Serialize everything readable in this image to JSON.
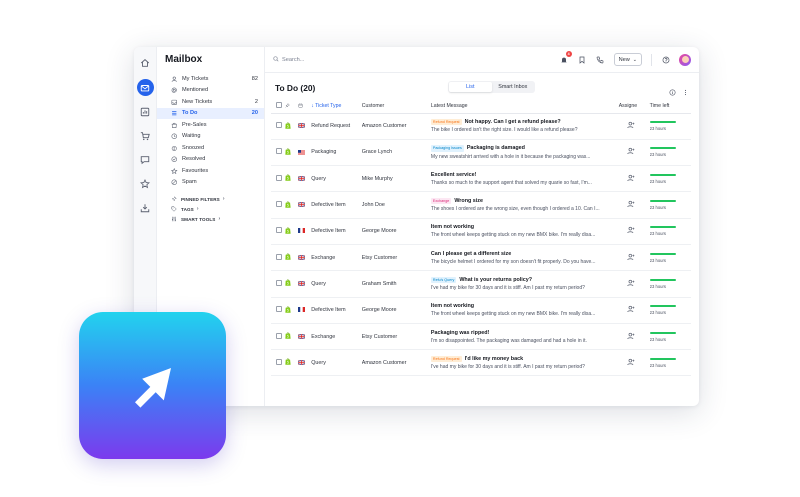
{
  "sidebar": {
    "title": "Mailbox",
    "folders": [
      {
        "label": "My Tickets",
        "count": "82",
        "icon": "user-icon"
      },
      {
        "label": "Mentioned",
        "count": "",
        "icon": "at-icon"
      },
      {
        "label": "New Tickets",
        "count": "2",
        "icon": "inbox-icon"
      },
      {
        "label": "To Do",
        "count": "20",
        "icon": "list-icon",
        "active": true
      },
      {
        "label": "Pre-Sales",
        "count": "",
        "icon": "shopping-bag-icon"
      },
      {
        "label": "Waiting",
        "count": "",
        "icon": "clock-icon"
      },
      {
        "label": "Snoozed",
        "count": "",
        "icon": "snooze-icon"
      },
      {
        "label": "Resolved",
        "count": "",
        "icon": "check-circle-icon"
      },
      {
        "label": "Favourites",
        "count": "",
        "icon": "star-icon"
      },
      {
        "label": "Spam",
        "count": "",
        "icon": "spam-icon"
      }
    ],
    "sections": [
      "PINNED FILTERS",
      "TAGS",
      "SMART TOOLS"
    ]
  },
  "topbar": {
    "search_placeholder": "Search...",
    "notification_count": "4",
    "new_button_label": "New"
  },
  "view": {
    "title": "To Do (20)",
    "toggle_list": "List",
    "toggle_smart": "Smart Inbox"
  },
  "table": {
    "headers": {
      "type": "Ticket Type",
      "customer": "Customer",
      "message": "Latest Message",
      "assignee": "Assigne",
      "time": "Time left"
    },
    "rows": [
      {
        "flag": "uk",
        "type": "Refund Request",
        "customer": "Amazon Customer",
        "tag": "Refund Request",
        "tag_color": "#f97316",
        "tag_bg": "#ffedd5",
        "subject": "Not happy. Can I get a refund please?",
        "preview": "The bike I ordered isn't the right size. I would like a refund please?",
        "time": "23 hours"
      },
      {
        "flag": "us",
        "type": "Packaging",
        "customer": "Grace Lynch",
        "tag": "Packaging Issues",
        "tag_color": "#0284c7",
        "tag_bg": "#e0f2fe",
        "subject": "Packaging is damaged",
        "preview": "My new sweatshirt arrived with a hole in it because the packaging was...",
        "time": "23 hours"
      },
      {
        "flag": "uk",
        "type": "Query",
        "customer": "Mike Murphy",
        "tag": "",
        "tag_color": "",
        "tag_bg": "",
        "subject": "Excellent service!",
        "preview": "Thanks so much to the support agent that solved my quarie so fast, I'm...",
        "time": "23 hours"
      },
      {
        "flag": "uk",
        "type": "Defective Item",
        "customer": "John Doe",
        "tag": "Exchange",
        "tag_color": "#db2777",
        "tag_bg": "#fce7f3",
        "subject": "Wrong size",
        "preview": "The shoes I ordered are the wrong size, even though I ordered a 10. Can I...",
        "time": "23 hours"
      },
      {
        "flag": "fr",
        "type": "Defective Item",
        "customer": "George Moore",
        "tag": "",
        "tag_color": "",
        "tag_bg": "",
        "subject": "Item not working",
        "preview": "The front wheel keeps getting stuck on my new BMX bike. I'm really disa...",
        "time": "23 hours"
      },
      {
        "flag": "uk",
        "type": "Exchange",
        "customer": "Etsy Customer",
        "tag": "",
        "tag_color": "",
        "tag_bg": "",
        "subject": "Can I please get a different size",
        "preview": "The bicycle helmet I ordered for my son doesn't fit properly. Do you have...",
        "time": "23 hours"
      },
      {
        "flag": "uk",
        "type": "Query",
        "customer": "Graham Smith",
        "tag": "Refu's Query",
        "tag_color": "#0284c7",
        "tag_bg": "#e0f2fe",
        "subject": "What is your returns policy?",
        "preview": "I've had my bike for 30 days and it is stiff. Am I past my return period?",
        "time": "23 hours"
      },
      {
        "flag": "fr",
        "type": "Defective Item",
        "customer": "George Moore",
        "tag": "",
        "tag_color": "",
        "tag_bg": "",
        "subject": "Item not working",
        "preview": "The front wheel keeps getting stuck on my new BMX bike. I'm really disa...",
        "time": "23 hours"
      },
      {
        "flag": "uk",
        "type": "Exchange",
        "customer": "Etsy Customer",
        "tag": "",
        "tag_color": "",
        "tag_bg": "",
        "subject": "Packaging was ripped!",
        "preview": "I'm so disappointed. The packaging was damaged and had a hole in it.",
        "time": "23 hours"
      },
      {
        "flag": "uk",
        "type": "Query",
        "customer": "Amazon Customer",
        "tag": "Refund Request",
        "tag_color": "#f97316",
        "tag_bg": "#ffedd5",
        "subject": "I'd like my money back",
        "preview": "I've had my bike for 30 days and it is stiff. Am I past my return period?",
        "time": "23 hours"
      }
    ]
  },
  "colors": {
    "accent": "#2563eb",
    "time_bar": "#22c55e"
  }
}
